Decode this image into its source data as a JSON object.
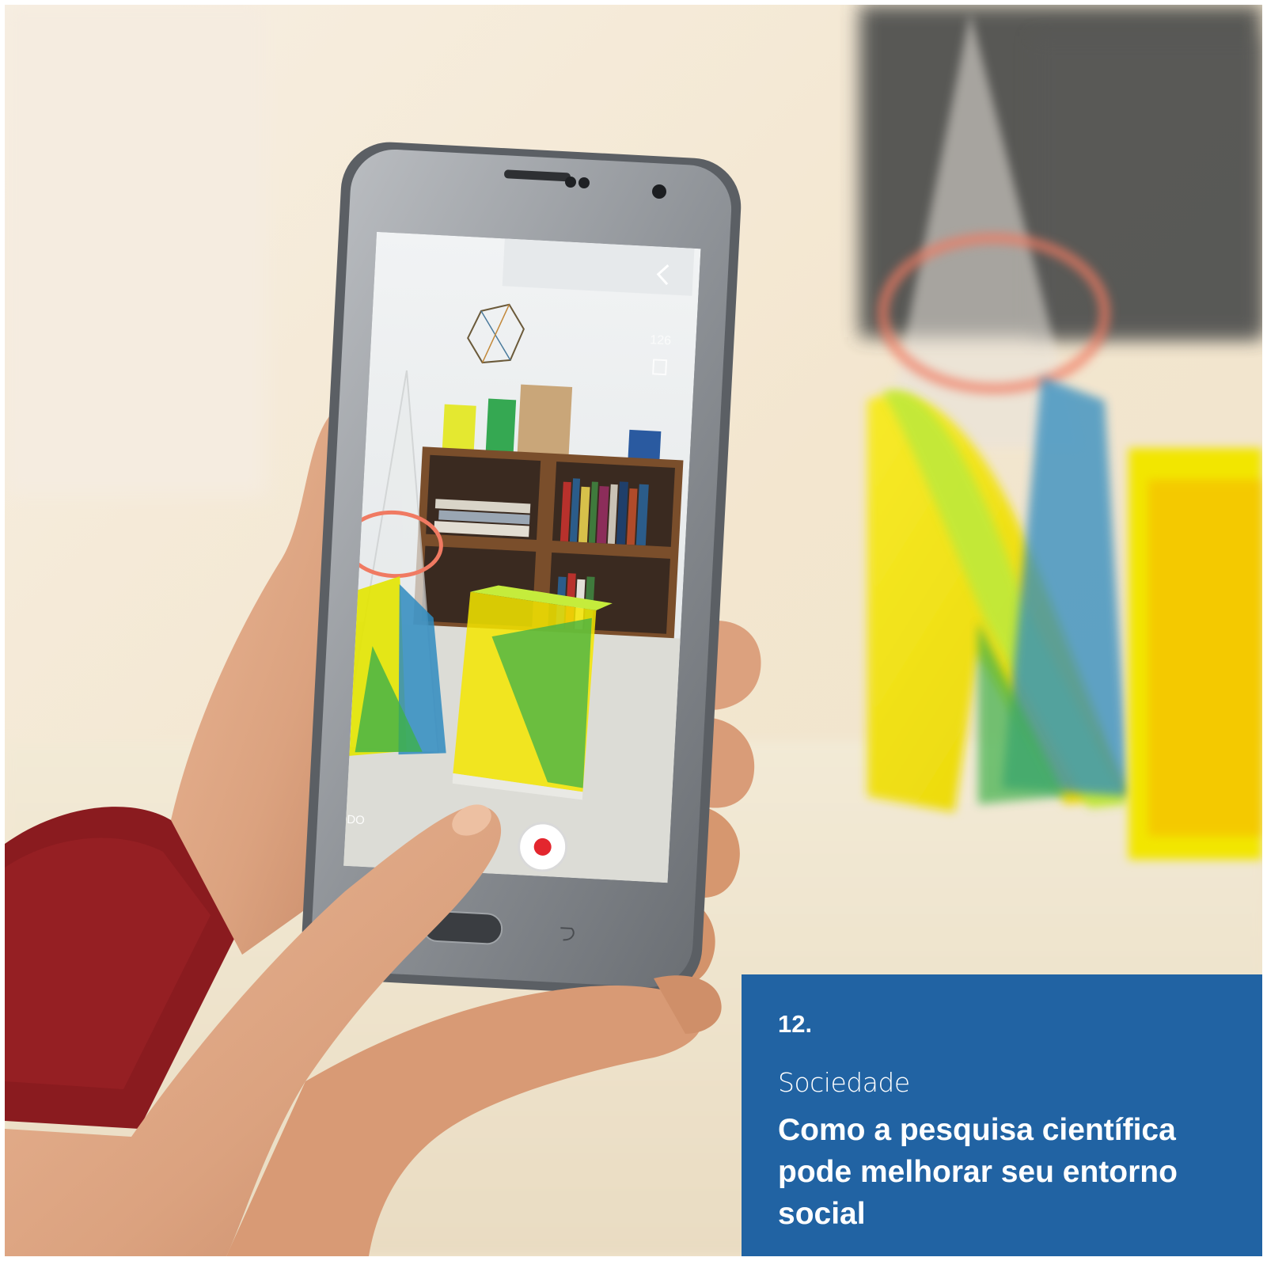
{
  "article": {
    "number": "12.",
    "category": "Sociedade",
    "title": "Como a pesquisa científica pode melhorar seu entorno social"
  },
  "photo": {
    "subject": "hand holding smartphone filming acrylic geometric solids",
    "phone_screen": {
      "mode_label": "MODO",
      "counter": "126"
    }
  },
  "colors": {
    "caption_background": "#2163a3",
    "caption_text": "#ffffff",
    "record_red": "#e3262e",
    "acrylic_yellow": "#f2e600",
    "acrylic_green": "#b8e82a",
    "acrylic_blue": "#2f8bc0",
    "sleeve_red": "#8a1b1f"
  }
}
